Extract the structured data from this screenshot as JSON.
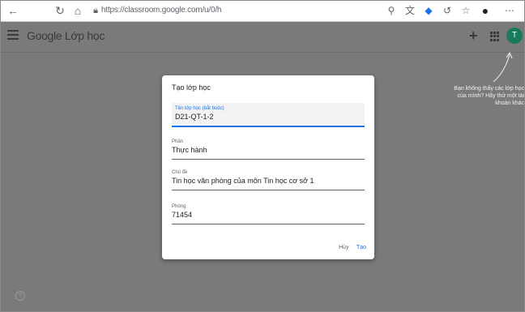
{
  "browser": {
    "url": "https://classroom.google.com/u/0/h",
    "icons": [
      "back-icon",
      "reload-icon",
      "home-icon",
      "lock-icon",
      "zoom-icon",
      "translate-icon",
      "extension-icon",
      "refresh-extension-icon",
      "favorites-icon",
      "profile-icon",
      "more-icon"
    ]
  },
  "app": {
    "title": "Google Lớp học",
    "avatar_letter": "T",
    "avatar_color": "#1a7a5e"
  },
  "annotation": {
    "text": "Bạn không thấy các lớp học của mình? Hãy thử một tài khoản khác"
  },
  "dialog": {
    "title": "Tạo lớp học",
    "fields": [
      {
        "label": "Tên lớp học (bắt buộc)",
        "value": "D21-QT-1-2"
      },
      {
        "label": "Phần",
        "value": "Thực hành"
      },
      {
        "label": "Chủ đề",
        "value": "Tin học văn phòng của môn Tin học cơ sở 1"
      },
      {
        "label": "Phòng",
        "value": "71454"
      }
    ],
    "cancel_label": "Hủy",
    "create_label": "Tạo"
  },
  "colors": {
    "backdrop": "#7a7a7a",
    "accent": "#1a73e8"
  }
}
